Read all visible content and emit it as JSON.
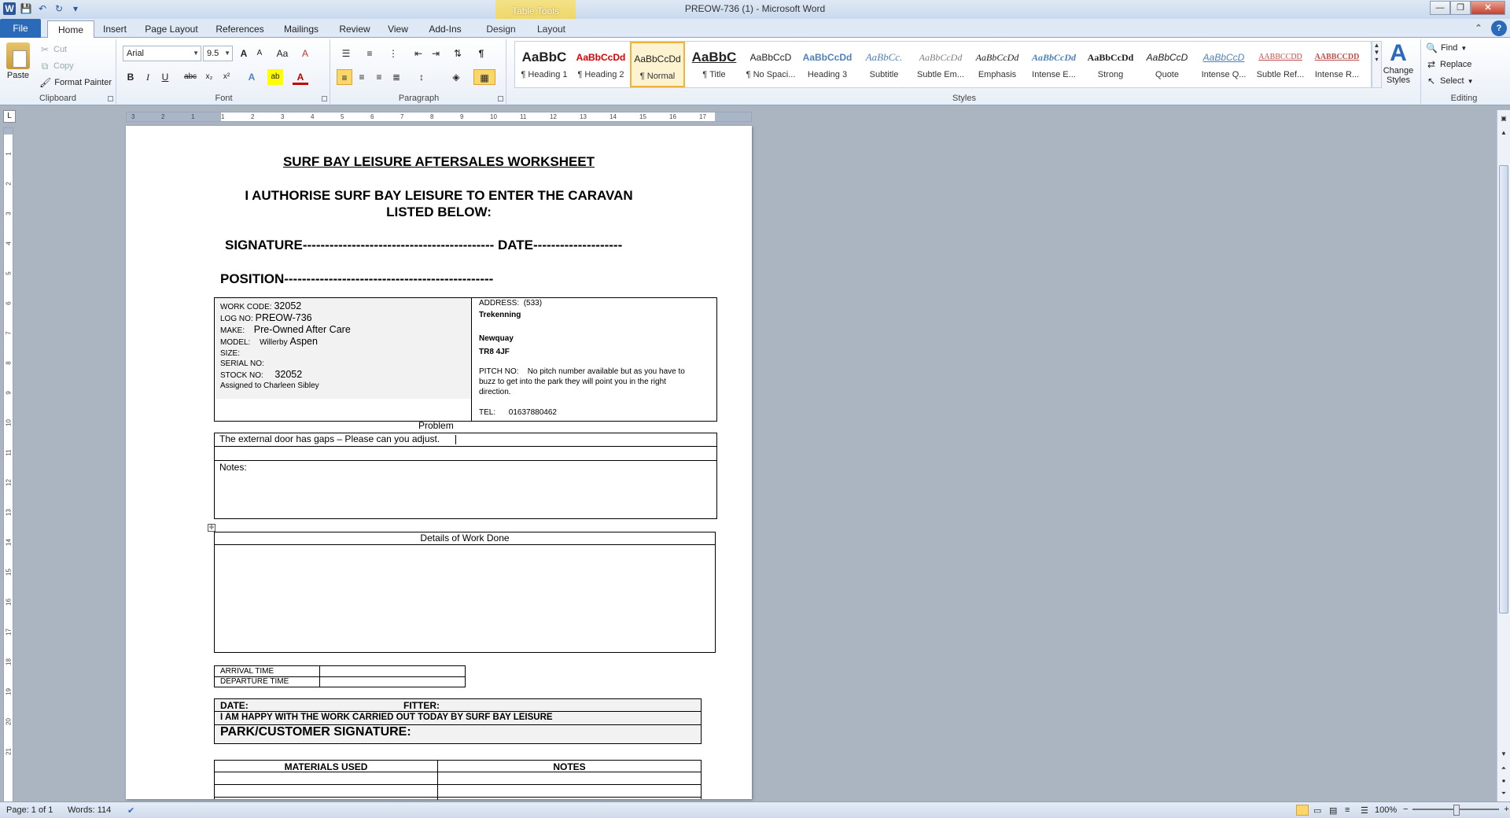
{
  "window": {
    "title": "PREOW-736 (1)  -  Microsoft Word",
    "contextual_tab_group": "Table Tools"
  },
  "qat": {
    "word_icon": "W",
    "save_icon": "save-icon",
    "undo_icon": "↶",
    "redo_icon": "↻",
    "customize": "▾"
  },
  "window_controls": {
    "minimize": "—",
    "maximize": "❐",
    "close": "✕"
  },
  "help": {
    "minimize_ribbon": "⌃",
    "help_icon": "?"
  },
  "tabs": [
    {
      "label": "File"
    },
    {
      "label": "Home"
    },
    {
      "label": "Insert"
    },
    {
      "label": "Page Layout"
    },
    {
      "label": "References"
    },
    {
      "label": "Mailings"
    },
    {
      "label": "Review"
    },
    {
      "label": "View"
    },
    {
      "label": "Add-Ins"
    },
    {
      "label": "Design"
    },
    {
      "label": "Layout"
    }
  ],
  "clipboard": {
    "paste": "Paste",
    "cut": "Cut",
    "copy": "Copy",
    "format_painter": "Format Painter",
    "label": "Clipboard"
  },
  "font": {
    "name": "Arial",
    "size": "9.5",
    "label": "Font",
    "grow": "A",
    "shrink": "A",
    "case": "Aa",
    "clear": "A",
    "bold": "B",
    "italic": "I",
    "underline": "U",
    "strike": "abc",
    "subscript": "x₂",
    "superscript": "x²",
    "effects": "A",
    "highlight": "ab",
    "color": "A"
  },
  "paragraph": {
    "label": "Paragraph",
    "show_marks": "¶"
  },
  "styles": {
    "label": "Styles",
    "items": [
      {
        "preview": "AaBbC",
        "name": "¶ Heading 1",
        "color": "#000000"
      },
      {
        "preview": "AaBbCcDd",
        "name": "¶ Heading 2",
        "color": "#e00000"
      },
      {
        "preview": "AaBbCcDd",
        "name": "¶ Normal",
        "color": "#000000"
      },
      {
        "preview": "AaBbC",
        "name": "¶ Title",
        "color": "#000000"
      },
      {
        "preview": "AaBbCcD",
        "name": "¶ No Spaci...",
        "color": "#000000"
      },
      {
        "preview": "AaBbCcDd",
        "name": "Heading 3",
        "color": "#4f81bd"
      },
      {
        "preview": "AaBbCc.",
        "name": "Subtitle",
        "color": "#4f81bd"
      },
      {
        "preview": "AaBbCcDd",
        "name": "Subtle Em...",
        "color": "#7f7f7f"
      },
      {
        "preview": "AaBbCcDd",
        "name": "Emphasis",
        "color": "#000000"
      },
      {
        "preview": "AaBbCcDd",
        "name": "Intense E...",
        "color": "#4f81bd"
      },
      {
        "preview": "AaBbCcDd",
        "name": "Strong",
        "color": "#000000"
      },
      {
        "preview": "AaBbCcD",
        "name": "Quote",
        "color": "#000000"
      },
      {
        "preview": "AaBbCcD",
        "name": "Intense Q...",
        "color": "#4f81bd"
      },
      {
        "preview": "AABBCCDD",
        "name": "Subtle Ref...",
        "color": "#c0504d"
      },
      {
        "preview": "AABBCCDD",
        "name": "Intense R...",
        "color": "#c0504d"
      }
    ],
    "change_styles": "Change Styles"
  },
  "editing": {
    "label": "Editing",
    "find": "Find",
    "replace": "Replace",
    "select": "Select"
  },
  "document": {
    "title": "SURF BAY LEISURE AFTERSALES WORKSHEET",
    "authorise_line1": "I AUTHORISE SURF BAY LEISURE TO ENTER THE CARAVAN",
    "authorise_line2": "LISTED BELOW:",
    "signature_line": "SIGNATURE------------------------------------------- DATE--------------------",
    "position_line": "POSITION-----------------------------------------------",
    "info": {
      "work_code_label": "WORK CODE:",
      "work_code": "32052",
      "log_no_label": "LOG NO:",
      "log_no": "PREOW-736",
      "make_label": "MAKE:",
      "make": "Pre-Owned  After Care",
      "model_label": "MODEL:",
      "model_brand": "Willerby",
      "model": "Aspen",
      "size_label": "SIZE:",
      "serial_label": "SERIAL  NO:",
      "stock_label": "STOCK NO:",
      "stock": "32052",
      "assigned": "Assigned to Charleen Sibley",
      "address_label": "ADDRESS:",
      "address_num": "(533)",
      "address_line1": "Trekenning",
      "address_line2": "Newquay",
      "postcode": "TR8 4JF",
      "pitch_label": "PITCH NO:",
      "pitch_line1": "No pitch number available but as you have to",
      "pitch_line2": "buzz  to get into the park they will point you in the right",
      "pitch_line3": "direction.",
      "tel_label": "TEL:",
      "tel": "01637880462"
    },
    "problem_heading": "Problem",
    "problem_text": "The external door has gaps – Please can you adjust.",
    "notes_label": "Notes:",
    "details_heading": "Details of Work Done",
    "arrival_label": "ARRIVAL  TIME",
    "departure_label": "DEPARTURE  TIME",
    "date_label": "DATE:",
    "fitter_label": "FITTER:",
    "happy_line": "I AM HAPPY WITH THE WORK CARRIED OUT TODAY BY SURF BAY LEISURE",
    "customer_sig": "PARK/CUSTOMER SIGNATURE:",
    "materials_heading": "MATERIALS USED",
    "notes_heading": "NOTES"
  },
  "hruler_numbers": [
    "3",
    "2",
    "1",
    "1",
    "2",
    "3",
    "4",
    "5",
    "6",
    "7",
    "8",
    "9",
    "10",
    "11",
    "12",
    "13",
    "14",
    "15",
    "16",
    "17"
  ],
  "vruler_numbers": [
    "1",
    "2",
    "3",
    "4",
    "5",
    "6",
    "7",
    "8",
    "9",
    "10",
    "11",
    "12",
    "13",
    "14",
    "15",
    "16",
    "17",
    "18",
    "19",
    "20",
    "21"
  ],
  "status": {
    "page": "Page: 1 of 1",
    "words": "Words: 114",
    "zoom": "100%",
    "zoom_out": "−",
    "zoom_in": "+"
  }
}
